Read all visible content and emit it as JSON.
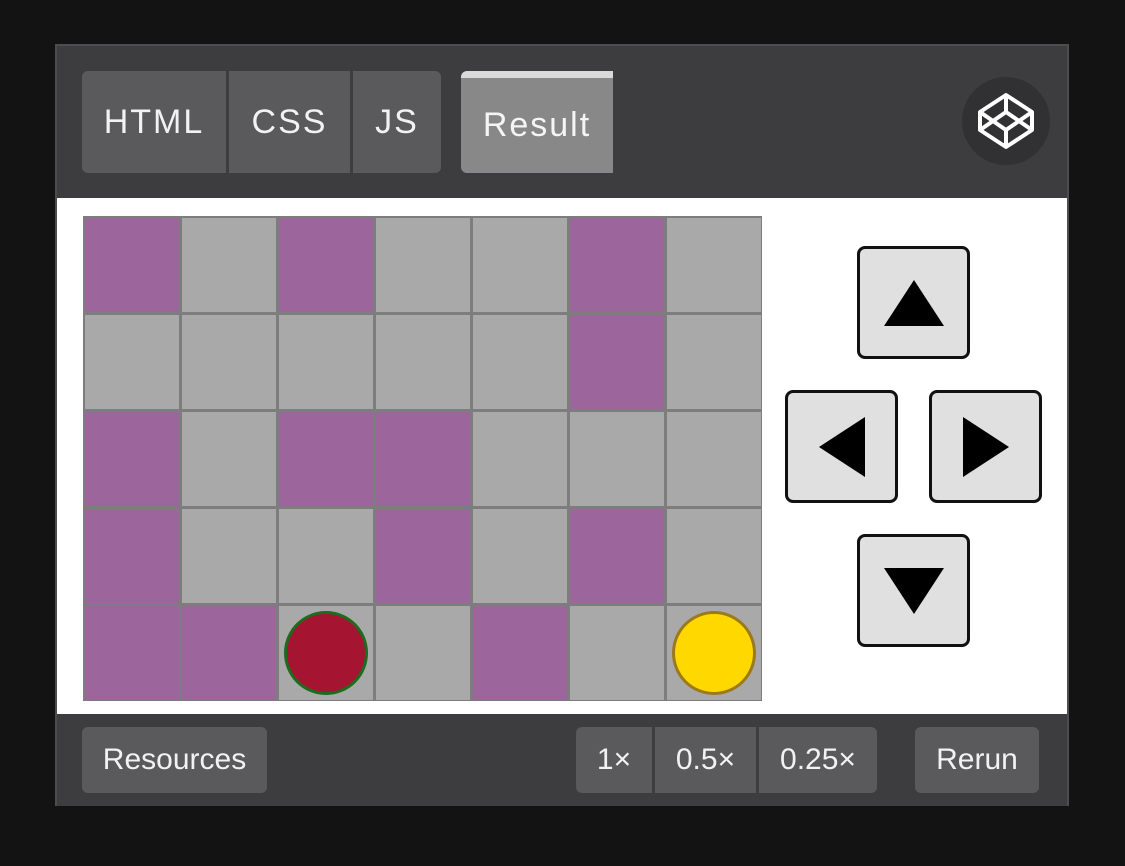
{
  "header": {
    "tabs": {
      "html": "HTML",
      "css": "CSS",
      "js": "JS"
    },
    "active_tab": "Result",
    "logo_icon": "codepen-logo-icon"
  },
  "game": {
    "rows": 5,
    "cols": 7,
    "board": [
      [
        "wall",
        "floor",
        "wall",
        "floor",
        "floor",
        "wall",
        "floor"
      ],
      [
        "floor",
        "floor",
        "floor",
        "floor",
        "floor",
        "wall",
        "floor"
      ],
      [
        "wall",
        "floor",
        "wall",
        "wall",
        "floor",
        "floor",
        "floor"
      ],
      [
        "wall",
        "floor",
        "floor",
        "wall",
        "floor",
        "wall",
        "floor"
      ],
      [
        "wall",
        "wall",
        "floor",
        "floor",
        "wall",
        "floor",
        "floor"
      ]
    ],
    "player": {
      "row": 4,
      "col": 2,
      "color": "#a51531"
    },
    "goal": {
      "row": 4,
      "col": 6,
      "color": "#ffd800"
    },
    "wall_color": "#9c659c",
    "floor_color": "#a9a9a9"
  },
  "controls": {
    "up_icon": "arrow-up-icon",
    "left_icon": "arrow-left-icon",
    "right_icon": "arrow-right-icon",
    "down_icon": "arrow-down-icon"
  },
  "footer": {
    "resources_label": "Resources",
    "speeds": {
      "s1": "1×",
      "s05": "0.5×",
      "s025": "0.25×"
    },
    "rerun_label": "Rerun"
  }
}
